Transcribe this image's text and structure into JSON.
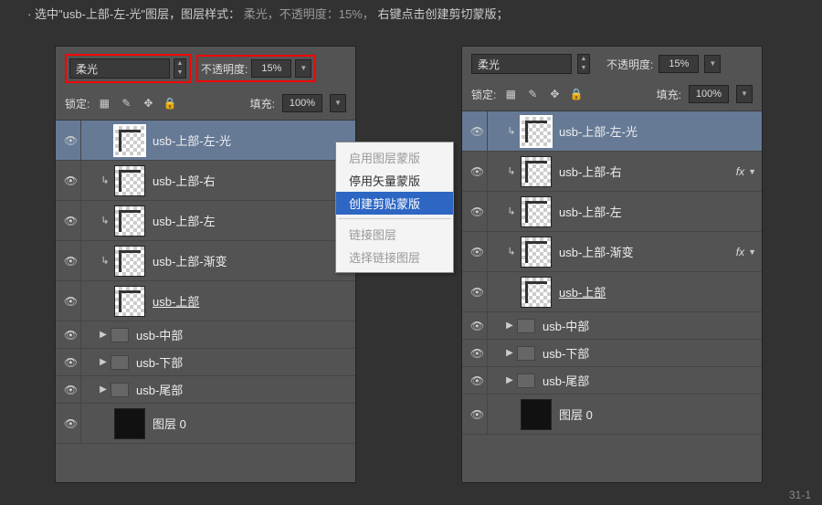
{
  "instruction": {
    "bullet": "·",
    "part1": "选中\"usb-上部-左-光\"图层，图层样式：",
    "part2": "柔光，不透明度：15%，",
    "part3": "右键点击创建剪切蒙版；"
  },
  "toolbar": {
    "blend_label": "柔光",
    "opacity_label": "不透明度:",
    "opacity_value": "15%",
    "lock_label": "锁定:",
    "fill_label": "填充:",
    "fill_value": "100%"
  },
  "context_menu": {
    "items": [
      {
        "label": "启用图层蒙版",
        "enabled": false
      },
      {
        "label": "停用矢量蒙版",
        "enabled": true
      },
      {
        "label": "创建剪贴蒙版",
        "enabled": true,
        "hover": true
      },
      {
        "sep": true
      },
      {
        "label": "链接图层",
        "enabled": false
      },
      {
        "label": "选择链接图层",
        "enabled": false
      }
    ]
  },
  "layers_left": [
    {
      "name": "usb-上部-左-光",
      "clip": false,
      "selected": true,
      "thumb": "checker shape sel"
    },
    {
      "name": "usb-上部-右",
      "clip": true,
      "thumb": "checker shape"
    },
    {
      "name": "usb-上部-左",
      "clip": true,
      "thumb": "checker shape"
    },
    {
      "name": "usb-上部-渐变",
      "clip": true,
      "thumb": "checker shape"
    },
    {
      "name": "usb-上部",
      "clip": false,
      "thumb": "checker shape",
      "underline": true
    },
    {
      "name": "usb-中部",
      "folder": true
    },
    {
      "name": "usb-下部",
      "folder": true
    },
    {
      "name": "usb-尾部",
      "folder": true
    },
    {
      "name": "图层 0",
      "bg": true,
      "thumb": "black"
    }
  ],
  "layers_right": [
    {
      "name": "usb-上部-左-光",
      "clip": true,
      "selected": true,
      "thumb": "checker shape sel"
    },
    {
      "name": "usb-上部-右",
      "clip": true,
      "thumb": "checker shape",
      "fx": true
    },
    {
      "name": "usb-上部-左",
      "clip": true,
      "thumb": "checker shape"
    },
    {
      "name": "usb-上部-渐变",
      "clip": true,
      "thumb": "checker shape",
      "fx": true
    },
    {
      "name": "usb-上部",
      "clip": false,
      "thumb": "checker shape",
      "underline": true
    },
    {
      "name": "usb-中部",
      "folder": true
    },
    {
      "name": "usb-下部",
      "folder": true
    },
    {
      "name": "usb-尾部",
      "folder": true
    },
    {
      "name": "图层 0",
      "bg": true,
      "thumb": "black"
    }
  ],
  "footer": "31-1"
}
